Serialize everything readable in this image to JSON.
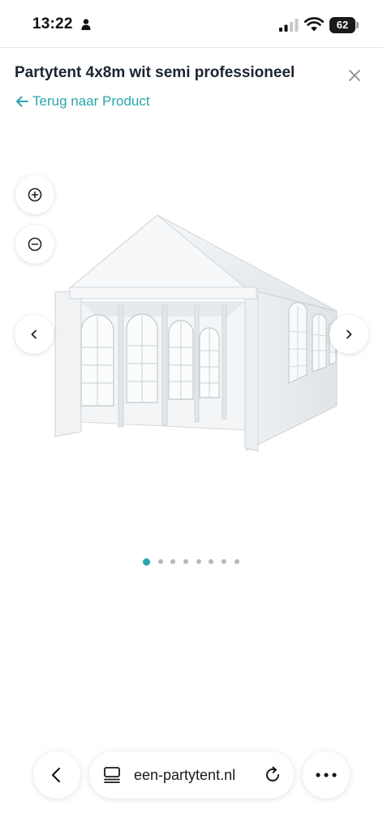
{
  "status_bar": {
    "time": "13:22",
    "battery": "62",
    "icons": [
      "person-icon",
      "cellular-signal-icon",
      "wifi-icon",
      "battery-icon"
    ]
  },
  "header": {
    "title": "Partytent 4x8m wit semi professioneel",
    "back_label": "Terug naar Product",
    "close_icon": "close-icon"
  },
  "gallery": {
    "image_count": 8,
    "active_index": 0,
    "controls": [
      "zoom-in-icon",
      "zoom-out-icon",
      "chevron-left-icon",
      "chevron-right-icon"
    ]
  },
  "browser": {
    "url": "een-partytent.nl",
    "controls": [
      "back-icon",
      "tabs-icon",
      "reload-icon",
      "more-icon"
    ]
  },
  "colors": {
    "accent": "#2aa6ad",
    "title": "#1b2430",
    "dot_inactive": "#b9b9b9"
  }
}
